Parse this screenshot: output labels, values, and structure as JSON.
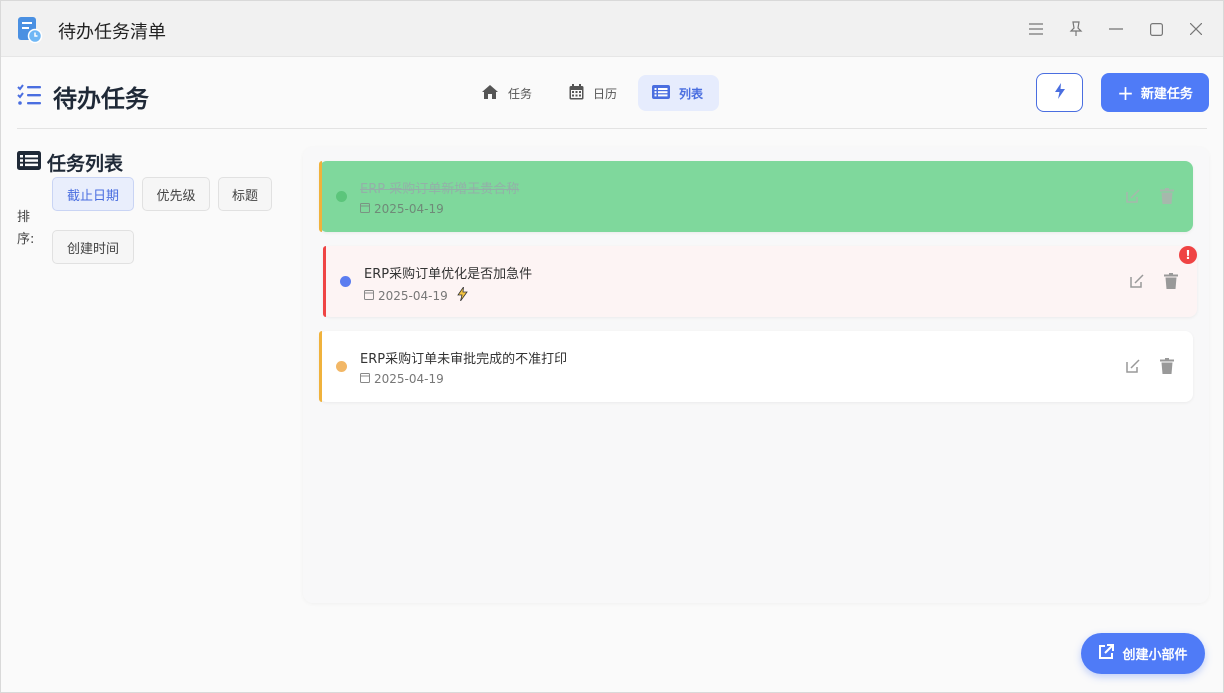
{
  "window": {
    "title": "待办任务清单"
  },
  "header": {
    "title": "待办任务",
    "tabs": [
      {
        "label": "任务",
        "icon": "home-icon",
        "active": false
      },
      {
        "label": "日历",
        "icon": "calendar-icon",
        "active": false
      },
      {
        "label": "列表",
        "icon": "list-icon",
        "active": true
      }
    ],
    "new_task_label": "新建任务"
  },
  "sidebar": {
    "title": "任务列表",
    "sort_label": "排序:",
    "sort_options": [
      {
        "label": "截止日期",
        "active": true
      },
      {
        "label": "优先级",
        "active": false
      },
      {
        "label": "标题",
        "active": false
      },
      {
        "label": "创建时间",
        "active": false
      }
    ]
  },
  "tasks": [
    {
      "title": "ERP 采购订单新增王贵合称",
      "date": "2025-04-19",
      "status": "done",
      "accent": "#f0b23c",
      "dot": "#5cc57b"
    },
    {
      "title": "ERP采购订单优化是否加急件",
      "date": "2025-04-19",
      "status": "urgent",
      "accent": "#ef4444",
      "dot": "#5b7df0",
      "badge": "!"
    },
    {
      "title": "ERP采购订单未审批完成的不准打印",
      "date": "2025-04-19",
      "status": "normal",
      "accent": "#f0b23c",
      "dot": "#f2b766"
    }
  ],
  "widget_button": {
    "label": "创建小部件"
  },
  "colors": {
    "accent": "#4f7bf7",
    "done_bg": "#7fd89c",
    "urgent_bg": "#fdf4f4"
  }
}
